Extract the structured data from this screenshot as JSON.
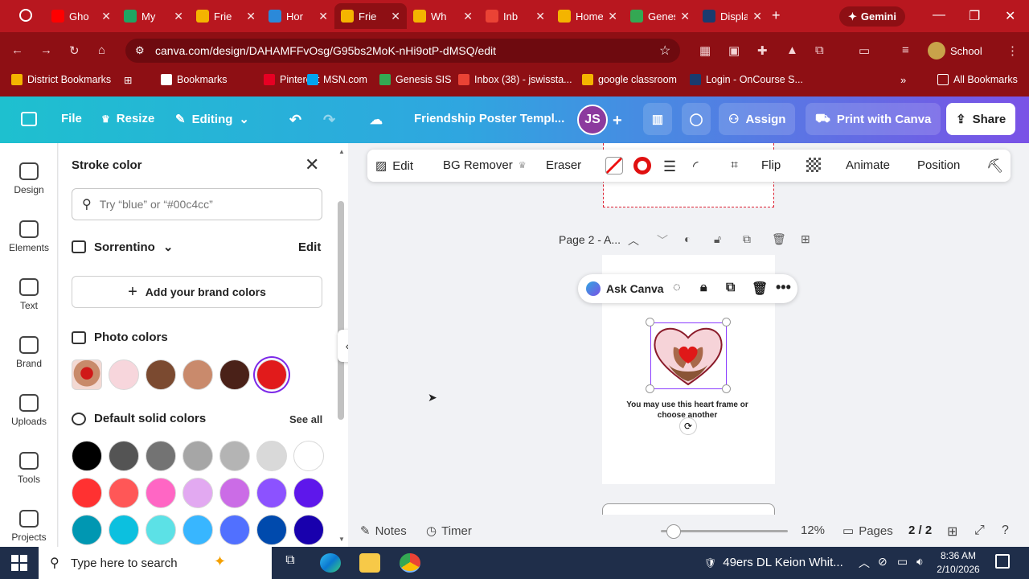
{
  "browser": {
    "tabs": [
      {
        "title": "Gho",
        "color": "#ff0000",
        "icon": "youtube-icon"
      },
      {
        "title": "My",
        "color": "#1fa463",
        "icon": "drive-icon"
      },
      {
        "title": "Frie",
        "color": "#f4b400",
        "icon": "slides-icon"
      },
      {
        "title": "Hor",
        "color": "#2b89d9",
        "icon": "canva-icon"
      },
      {
        "title": "Frie",
        "color": "#f4b400",
        "icon": "slides-icon",
        "active": true
      },
      {
        "title": "Wh",
        "color": "#f4b400",
        "icon": "slides-icon"
      },
      {
        "title": "Inb",
        "color": "#ea4335",
        "icon": "gmail-icon"
      },
      {
        "title": "Home -",
        "color": "#f4b400",
        "icon": "classroom-icon"
      },
      {
        "title": "Genesis",
        "color": "#34a853",
        "icon": "genesis-icon"
      },
      {
        "title": "Display",
        "color": "#1a3b6e",
        "icon": "dn-icon"
      }
    ],
    "gemini_label": "Gemini",
    "url": "canva.com/design/DAHAMFFvOsg/G95bs2MoK-nHi9otP-dMSQ/edit",
    "profile_label": "School",
    "bookmarks": [
      {
        "label": "District Bookmarks",
        "color": "#f4b400"
      },
      {
        "label": "Bookmarks",
        "color": "#ffffff"
      },
      {
        "label": "Pinterest",
        "color": "#e60023"
      },
      {
        "label": "MSN.com",
        "color": "#00a4ef"
      },
      {
        "label": "Genesis SIS",
        "color": "#34a853"
      },
      {
        "label": "Inbox (38) - jswissta...",
        "color": "#ea4335"
      },
      {
        "label": "google classroom",
        "color": "#f4b400"
      },
      {
        "label": "Login - OnCourse S...",
        "color": "#1a3b6e"
      }
    ],
    "all_bookmarks_label": "All Bookmarks"
  },
  "canva_header": {
    "file": "File",
    "resize": "Resize",
    "editing": "Editing",
    "doc_title": "Friendship Poster Templ...",
    "avatar_initials": "JS",
    "assign": "Assign",
    "print": "Print with Canva",
    "share": "Share"
  },
  "rail": [
    {
      "label": "Design",
      "icon": "design-icon"
    },
    {
      "label": "Elements",
      "icon": "elements-icon"
    },
    {
      "label": "Text",
      "icon": "text-icon"
    },
    {
      "label": "Brand",
      "icon": "brand-icon"
    },
    {
      "label": "Uploads",
      "icon": "uploads-icon"
    },
    {
      "label": "Tools",
      "icon": "tools-icon"
    },
    {
      "label": "Projects",
      "icon": "projects-icon"
    }
  ],
  "panel": {
    "title": "Stroke color",
    "search_placeholder": "Try “blue” or “#00c4cc”",
    "brand_kit": "Sorrentino",
    "edit": "Edit",
    "add_brand": "Add your brand colors",
    "photo_colors": "Photo colors",
    "photo_swatches": [
      "#f7d6dc",
      "#7b4a30",
      "#c98a6c",
      "#4a2118",
      "#e11b1b"
    ],
    "default_colors": "Default solid colors",
    "see_all": "See all",
    "default_swatches": [
      [
        "#000000",
        "#545454",
        "#737373",
        "#a6a6a6",
        "#b4b4b4",
        "#d9d9d9",
        "#ffffff"
      ],
      [
        "#ff3131",
        "#ff5757",
        "#ff66c4",
        "#e2a9f1",
        "#cb6ce6",
        "#8c52ff",
        "#5e17eb"
      ],
      [
        "#0097b2",
        "#0cc0df",
        "#5ce1e6",
        "#38b6ff",
        "#5170ff",
        "#004aad",
        "#1800ad"
      ]
    ]
  },
  "context_toolbar": {
    "edit": "Edit",
    "bg_remover": "BG Remover",
    "eraser": "Eraser",
    "flip": "Flip",
    "animate": "Animate",
    "position": "Position"
  },
  "canvas": {
    "page_label": "Page 2 - A...",
    "ask_canva": "Ask Canva",
    "caption": "You may use this heart frame or choose another"
  },
  "footer": {
    "notes": "Notes",
    "timer": "Timer",
    "zoom": "12%",
    "zoom_level": 0.12,
    "pages": "Pages",
    "page_count": "2 / 2"
  },
  "taskbar": {
    "search_placeholder": "Type here to search",
    "news": "49ers DL Keion Whit...",
    "time": "8:36 AM",
    "date": "2/10/2026"
  }
}
